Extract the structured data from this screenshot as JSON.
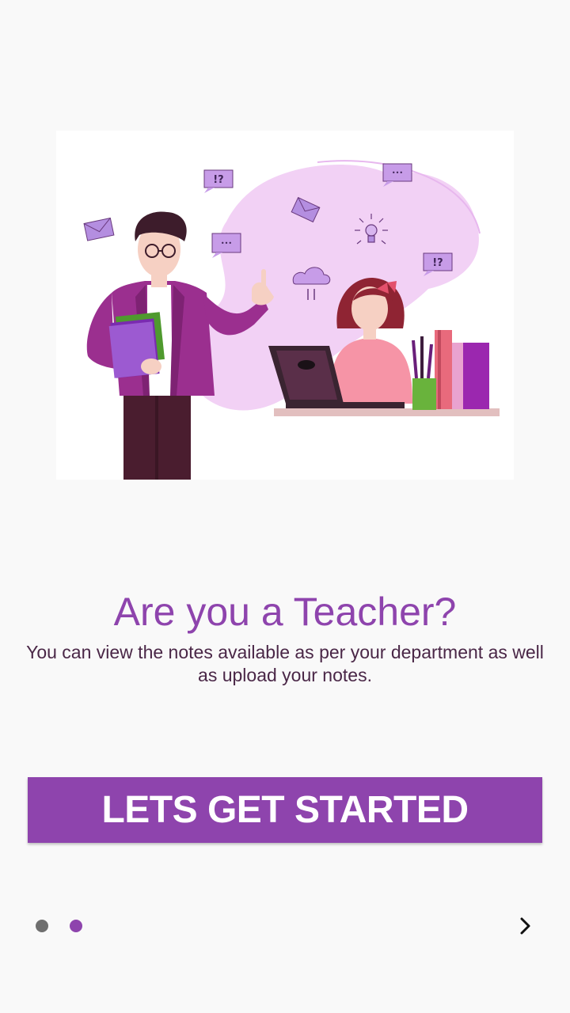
{
  "onboarding": {
    "title": "Are you a Teacher?",
    "description": "You can view the notes available as per your department as well as upload your notes.",
    "cta_label": "LETS GET STARTED",
    "pager": {
      "current_page": 2,
      "total_pages": 2
    }
  },
  "illustration": {
    "speech_bubble_question": "!?",
    "speech_bubble_dots": "•••"
  },
  "colors": {
    "accent": "#8e44ad",
    "background": "#f9f9f9",
    "dot_inactive": "#6f6f6f",
    "subtitle": "#4a2747"
  },
  "icons": {
    "next": "chevron-right-icon"
  }
}
